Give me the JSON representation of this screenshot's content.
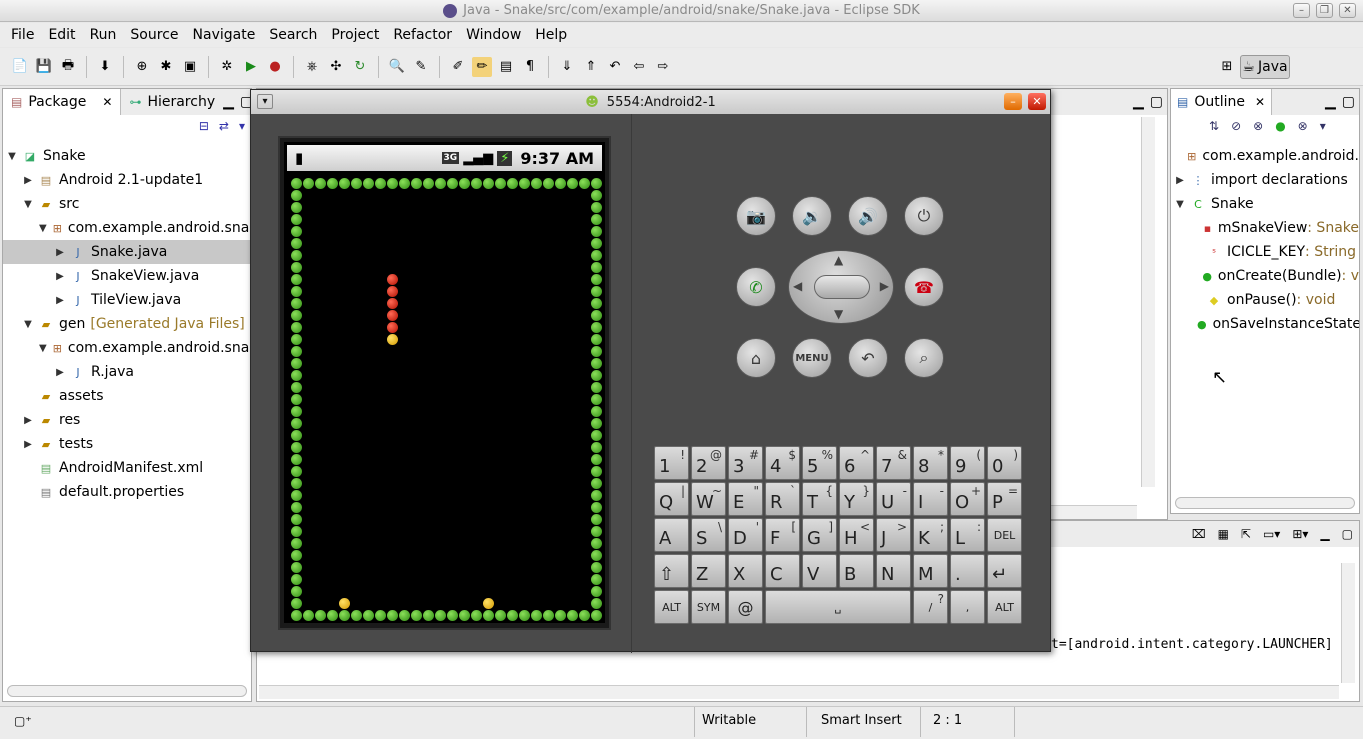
{
  "window": {
    "title": "Java - Snake/src/com/example/android/snake/Snake.java - Eclipse SDK"
  },
  "menu": [
    "File",
    "Edit",
    "Run",
    "Source",
    "Navigate",
    "Search",
    "Project",
    "Refactor",
    "Window",
    "Help"
  ],
  "perspective": {
    "label": "Java"
  },
  "package_explorer": {
    "tab_label": "Package",
    "hierarchy_label": "Hierarchy",
    "items": [
      {
        "label": "Snake",
        "level": 0,
        "expanded": true,
        "icon": "project-icon"
      },
      {
        "label": "Android 2.1-update1",
        "level": 1,
        "expanded": false,
        "icon": "library-icon"
      },
      {
        "label": "src",
        "level": 1,
        "expanded": true,
        "icon": "source-folder-icon"
      },
      {
        "label": "com.example.android.snake",
        "level": 2,
        "expanded": true,
        "icon": "package-icon"
      },
      {
        "label": "Snake.java",
        "level": 3,
        "expanded": false,
        "icon": "java-file-icon",
        "selected": true
      },
      {
        "label": "SnakeView.java",
        "level": 3,
        "expanded": false,
        "icon": "java-file-icon"
      },
      {
        "label": "TileView.java",
        "level": 3,
        "expanded": false,
        "icon": "java-file-icon"
      },
      {
        "label": "gen",
        "suffix": "[Generated Java Files]",
        "level": 1,
        "expanded": true,
        "icon": "source-folder-icon"
      },
      {
        "label": "com.example.android.snake",
        "level": 2,
        "expanded": true,
        "icon": "package-icon"
      },
      {
        "label": "R.java",
        "level": 3,
        "expanded": false,
        "icon": "java-file-icon"
      },
      {
        "label": "assets",
        "level": 1,
        "icon": "folder-icon"
      },
      {
        "label": "res",
        "level": 1,
        "expanded": false,
        "icon": "folder-icon"
      },
      {
        "label": "tests",
        "level": 1,
        "expanded": false,
        "icon": "folder-icon"
      },
      {
        "label": "AndroidManifest.xml",
        "level": 1,
        "icon": "xml-file-icon"
      },
      {
        "label": "default.properties",
        "level": 1,
        "icon": "file-icon"
      }
    ]
  },
  "outline": {
    "tab_label": "Outline",
    "items": [
      {
        "label": "com.example.android.",
        "type": "",
        "icon": "package-icon"
      },
      {
        "label": "import declarations",
        "type": "",
        "icon": "import-icon"
      },
      {
        "label": "Snake",
        "type": "",
        "icon": "class-icon"
      },
      {
        "label": "mSnakeView",
        "type": " : Snake",
        "icon": "private-field-icon"
      },
      {
        "label": "ICICLE_KEY",
        "type": " : String",
        "icon": "static-field-icon"
      },
      {
        "label": "onCreate(Bundle)",
        "type": " : v",
        "icon": "public-method-icon"
      },
      {
        "label": "onPause()",
        "type": " : void",
        "icon": "protected-method-icon"
      },
      {
        "label": "onSaveInstanceState",
        "type": "",
        "icon": "public-method-icon"
      }
    ]
  },
  "console": {
    "line": "t=[android.intent.category.LAUNCHER]"
  },
  "status": {
    "writable": "Writable",
    "insert_mode": "Smart Insert",
    "position": "2 : 1"
  },
  "emulator": {
    "title": "5554:Android2-1",
    "phone_time": "9:37 AM",
    "network": "3G",
    "keyboard_rows": [
      [
        [
          "1",
          "!"
        ],
        [
          "2",
          "@"
        ],
        [
          "3",
          "#"
        ],
        [
          "4",
          "$"
        ],
        [
          "5",
          "%"
        ],
        [
          "6",
          "^"
        ],
        [
          "7",
          "&"
        ],
        [
          "8",
          "*"
        ],
        [
          "9",
          "("
        ],
        [
          "0",
          ")"
        ]
      ],
      [
        [
          "Q",
          "|"
        ],
        [
          "W",
          "~"
        ],
        [
          "E",
          "\""
        ],
        [
          "R",
          "`"
        ],
        [
          "T",
          "{"
        ],
        [
          "Y",
          "}"
        ],
        [
          "U",
          "-"
        ],
        [
          "I",
          "-"
        ],
        [
          "O",
          "+"
        ],
        [
          "P",
          "="
        ]
      ],
      [
        [
          "A",
          ""
        ],
        [
          "S",
          "\\"
        ],
        [
          "D",
          "'"
        ],
        [
          "F",
          "["
        ],
        [
          "G",
          "]"
        ],
        [
          "H",
          "<"
        ],
        [
          "J",
          ">"
        ],
        [
          "K",
          ";"
        ],
        [
          "L",
          ":"
        ],
        [
          "DEL",
          ""
        ]
      ],
      [
        [
          "⇧",
          ""
        ],
        [
          "Z",
          ""
        ],
        [
          "X",
          ""
        ],
        [
          "C",
          ""
        ],
        [
          "V",
          ""
        ],
        [
          "B",
          ""
        ],
        [
          "N",
          ""
        ],
        [
          "M",
          ""
        ],
        [
          ".",
          ""
        ],
        [
          "↵",
          ""
        ]
      ]
    ],
    "bottom_keys": {
      "alt_left": "ALT",
      "sym": "SYM",
      "at": "@",
      "space": "␣",
      "slash": "/",
      "question": "?",
      "comma": ",",
      "alt_right": "ALT"
    },
    "menu_key": "MENU",
    "snake": {
      "body_red": 5,
      "head_yellow": 1,
      "apples": 2
    }
  }
}
